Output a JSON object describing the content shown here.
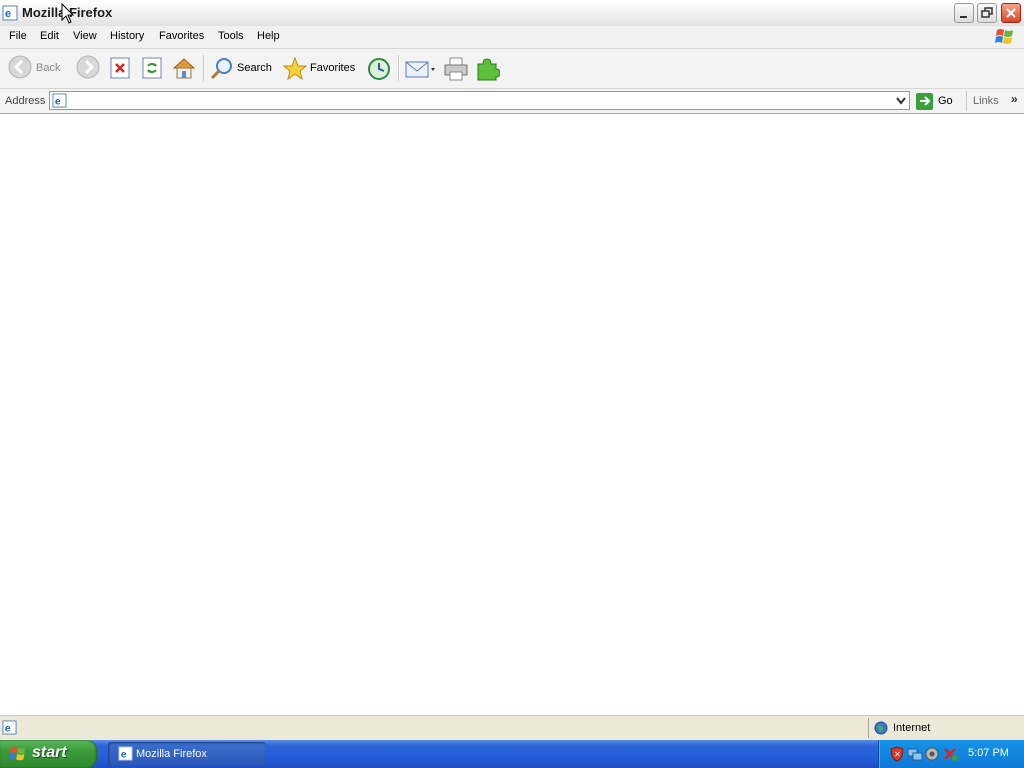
{
  "window": {
    "title": "Mozilla Firefox"
  },
  "menu": [
    "File",
    "Edit",
    "View",
    "History",
    "Favorites",
    "Tools",
    "Help"
  ],
  "toolbar": {
    "back_label": "Back",
    "search_label": "Search",
    "favorites_label": "Favorites"
  },
  "address": {
    "label": "Address",
    "value": "",
    "go_label": "Go",
    "links_label": "Links"
  },
  "status": {
    "zone_label": "Internet"
  },
  "taskbar": {
    "start_label": "start",
    "task_label": "Mozilla Firefox",
    "clock": "5:07 PM"
  },
  "icons": [
    "ie-page-icon",
    "back-icon",
    "forward-icon",
    "stop-icon",
    "refresh-icon",
    "home-icon",
    "search-icon",
    "favorites-star-icon",
    "history-icon",
    "mail-icon",
    "print-icon",
    "puzzle-icon"
  ]
}
